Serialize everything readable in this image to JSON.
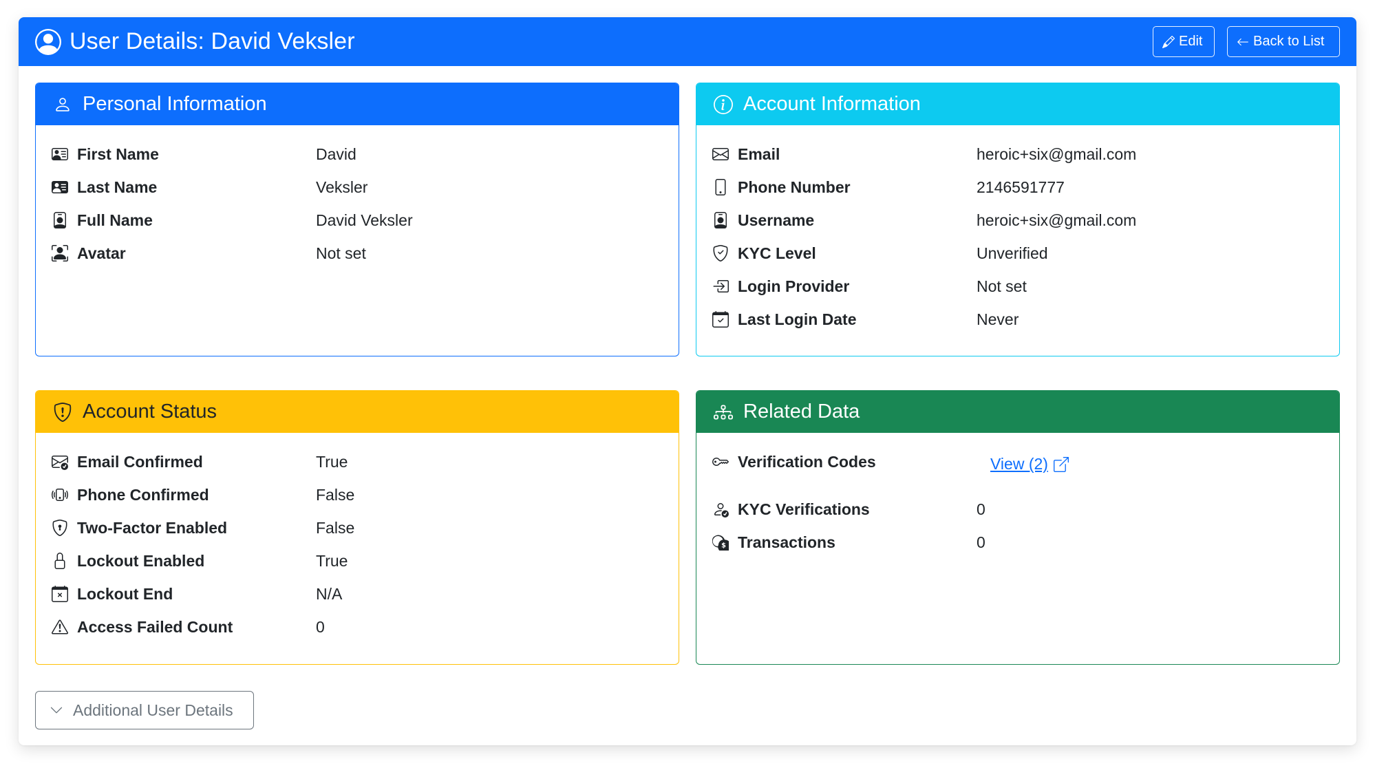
{
  "header": {
    "title": "User Details: David Veksler",
    "edit_label": "Edit",
    "back_label": "Back to List"
  },
  "personal": {
    "title": "Personal Information",
    "rows": [
      {
        "label": "First Name",
        "value": "David",
        "icon": "person-vcard-icon"
      },
      {
        "label": "Last Name",
        "value": "Veksler",
        "icon": "person-vcard-fill-icon"
      },
      {
        "label": "Full Name",
        "value": "David Veksler",
        "icon": "person-badge-icon"
      },
      {
        "label": "Avatar",
        "value": "Not set",
        "icon": "person-bounding-box-icon"
      }
    ]
  },
  "account": {
    "title": "Account Information",
    "rows": [
      {
        "label": "Email",
        "value": "heroic+six@gmail.com",
        "icon": "envelope-icon"
      },
      {
        "label": "Phone Number",
        "value": "2146591777",
        "icon": "phone-icon"
      },
      {
        "label": "Username",
        "value": "heroic+six@gmail.com",
        "icon": "person-badge-icon"
      },
      {
        "label": "KYC Level",
        "value": "Unverified",
        "icon": "shield-check-icon"
      },
      {
        "label": "Login Provider",
        "value": "Not set",
        "icon": "box-arrow-in-right-icon"
      },
      {
        "label": "Last Login Date",
        "value": "Never",
        "icon": "calendar-check-icon"
      }
    ]
  },
  "status": {
    "title": "Account Status",
    "rows": [
      {
        "label": "Email Confirmed",
        "value": "True",
        "icon": "envelope-check-icon"
      },
      {
        "label": "Phone Confirmed",
        "value": "False",
        "icon": "phone-vibrate-icon"
      },
      {
        "label": "Two-Factor Enabled",
        "value": "False",
        "icon": "shield-lock-icon"
      },
      {
        "label": "Lockout Enabled",
        "value": "True",
        "icon": "lock-icon"
      },
      {
        "label": "Lockout End",
        "value": "N/A",
        "icon": "calendar-x-icon"
      },
      {
        "label": "Access Failed Count",
        "value": "0",
        "icon": "exclamation-triangle-icon"
      }
    ]
  },
  "related": {
    "title": "Related Data",
    "rows": [
      {
        "label": "Verification Codes",
        "value": "View (2)",
        "icon": "key-icon",
        "link": true
      },
      {
        "label": "KYC Verifications",
        "value": "0",
        "icon": "person-check-icon"
      },
      {
        "label": "Transactions",
        "value": "0",
        "icon": "coin-icon"
      }
    ]
  },
  "additional": {
    "label": "Additional User Details"
  },
  "colors": {
    "primary": "#0d6efd",
    "info": "#0dcaf0",
    "warning": "#ffc107",
    "success": "#198754",
    "secondary": "#6c757d"
  }
}
